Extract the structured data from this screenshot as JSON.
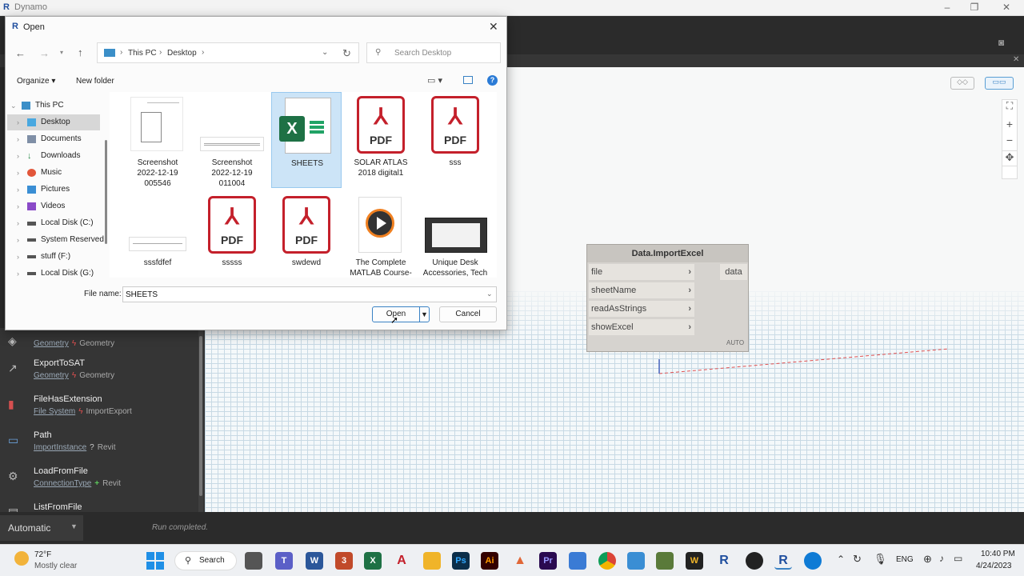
{
  "window": {
    "title": "Dynamo"
  },
  "dialog": {
    "title": "Open",
    "breadcrumb": [
      "This PC",
      "Desktop"
    ],
    "search_placeholder": "Search Desktop",
    "organize": "Organize",
    "new_folder": "New folder",
    "file_name_label": "File name:",
    "file_name_value": "SHEETS",
    "open_btn": "Open",
    "cancel_btn": "Cancel",
    "nav": [
      "This PC",
      "Desktop",
      "Documents",
      "Downloads",
      "Music",
      "Pictures",
      "Videos",
      "Local Disk (C:)",
      "System Reserved",
      "stuff (F:)",
      "Local Disk (G:)"
    ],
    "files": [
      {
        "name": "Screenshot\n2022-12-19\n005546",
        "type": "image"
      },
      {
        "name": "Screenshot\n2022-12-19\n011004",
        "type": "image"
      },
      {
        "name": "SHEETS",
        "type": "excel",
        "selected": true
      },
      {
        "name": "SOLAR ATLAS\n2018 digital1",
        "type": "pdf"
      },
      {
        "name": "sss",
        "type": "pdf"
      },
      {
        "name": "sssfdfef",
        "type": "image"
      },
      {
        "name": "sssss",
        "type": "pdf"
      },
      {
        "name": "swdewd",
        "type": "pdf"
      },
      {
        "name": "The Complete\nMATLAB Course-",
        "type": "video"
      },
      {
        "name": "Unique Desk\nAccessories, Tech",
        "type": "video-thumb"
      }
    ],
    "pdf_label": "PDF",
    "excel_label": "X"
  },
  "node": {
    "title": "Data.ImportExcel",
    "inputs": [
      "file",
      "sheetName",
      "readAsStrings",
      "showExcel"
    ],
    "output": "data",
    "lacing": "AUTO"
  },
  "library": [
    {
      "name": "",
      "category": "Geometry",
      "group": "Geometry",
      "marker": "ϟ"
    },
    {
      "name": "ExportToSAT",
      "category": "Geometry",
      "group": "Geometry",
      "marker": "ϟ"
    },
    {
      "name": "FileHasExtension",
      "category": "File System",
      "group": "ImportExport",
      "marker": "ϟ"
    },
    {
      "name": "Path",
      "category": "ImportInstance",
      "group": "Revit",
      "marker": "?"
    },
    {
      "name": "LoadFromFile",
      "category": "ConnectionType",
      "group": "Revit",
      "marker": "+"
    },
    {
      "name": "ListFromFile",
      "category": "",
      "group": "",
      "marker": ""
    }
  ],
  "status": {
    "run_mode": "Automatic",
    "message": "Run completed."
  },
  "taskbar": {
    "weather_temp": "72°F",
    "weather_desc": "Mostly clear",
    "search": "Search",
    "lang": "ENG",
    "time": "10:40 PM",
    "date": "4/24/2023"
  },
  "colors": {
    "pdf_red": "#c4202b",
    "excel_green": "#1e7145",
    "selection": "#cce4f7"
  }
}
